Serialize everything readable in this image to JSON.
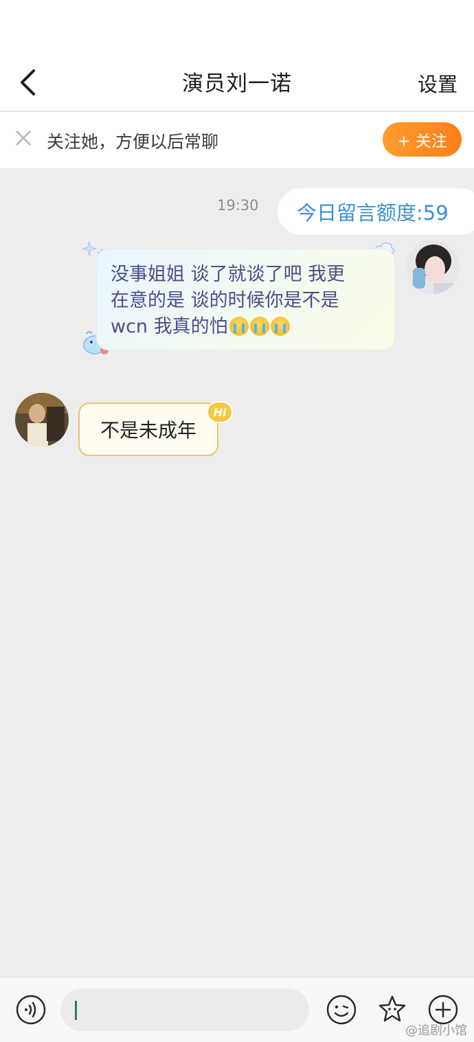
{
  "header": {
    "title": "演员刘一诺",
    "settings_label": "设置"
  },
  "follow_banner": {
    "text": "关注她，方便以后常聊",
    "button_label": "+ 关注"
  },
  "chat": {
    "timestamp": "19:30",
    "quota_text": "今日留言额度:59",
    "sent_message": {
      "lines": [
        "没事姐姐 谈了就谈了吧 我更",
        "在意的是 谈的时候你是不是",
        "wcn 我真的怕"
      ],
      "emoji": [
        "crying-face",
        "crying-face",
        "crying-face"
      ]
    },
    "received_message": {
      "text": "不是未成年",
      "badge": "Hi"
    }
  },
  "input_bar": {
    "placeholder": ""
  },
  "watermark": "@追剧小馆",
  "colors": {
    "accent_orange": "#ff8a1f",
    "quota_blue": "#3a8fd9",
    "bubble_text": "#4a4f8a"
  }
}
